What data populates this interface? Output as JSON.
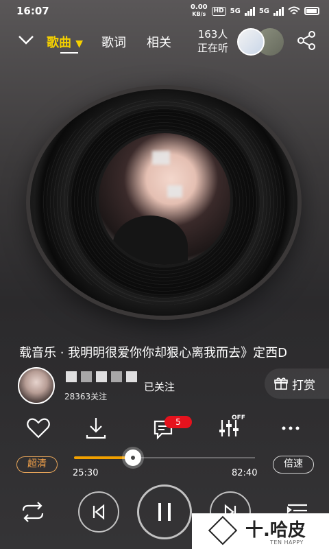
{
  "status_bar": {
    "time": "16:07",
    "net_speed": "0.00",
    "net_unit": "KB/s",
    "hd_label": "HD",
    "sig1": "5G",
    "sig2": "5G"
  },
  "header": {
    "tabs": [
      {
        "label": "歌曲"
      },
      {
        "label": "歌词"
      },
      {
        "label": "相关"
      }
    ],
    "listeners_count": "163人",
    "listeners_label": "正在听"
  },
  "song_marquee": "载音乐 · 我明明很爱你你却狠心离我而去》定西D",
  "uploader": {
    "fans": "28363关注",
    "follow_label": "已关注",
    "reward_label": "打赏"
  },
  "actions": {
    "comment_count": "5",
    "eq_label": "OFF"
  },
  "player": {
    "quality_label": "超清",
    "current_time": "25:30",
    "total_time": "82:40",
    "progress": 0.31,
    "speed_label": "倍速"
  },
  "watermark": {
    "title": "十.哈皮",
    "subtitle": "TEN HAPPY"
  },
  "colors": {
    "accent": "#f5d000",
    "progress": "#f2a100",
    "badge": "#e5121d",
    "quality": "#f0a04a"
  }
}
